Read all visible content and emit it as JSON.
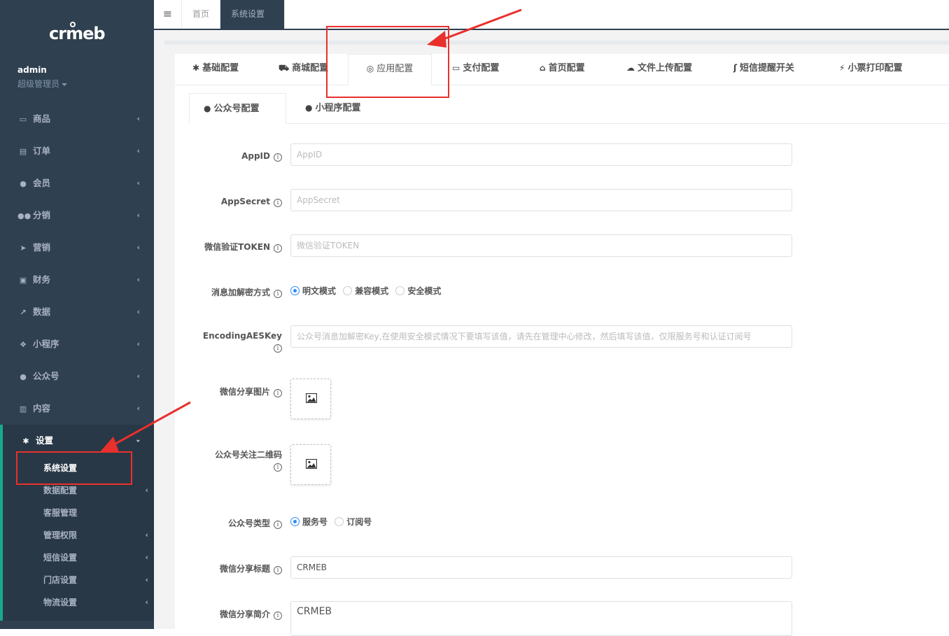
{
  "sidebar": {
    "logo": "crmeb",
    "user_name": "admin",
    "user_role": "超级管理员",
    "menu": [
      {
        "label": "商品",
        "icon": "laptop-icon"
      },
      {
        "label": "订单",
        "icon": "list-icon"
      },
      {
        "label": "会员",
        "icon": "user-icon"
      },
      {
        "label": "分销",
        "icon": "users-icon"
      },
      {
        "label": "营销",
        "icon": "paper-plane-icon"
      },
      {
        "label": "财务",
        "icon": "money-icon"
      },
      {
        "label": "数据",
        "icon": "chart-icon"
      },
      {
        "label": "小程序",
        "icon": "cubes-icon"
      },
      {
        "label": "公众号",
        "icon": "wechat-icon"
      },
      {
        "label": "内容",
        "icon": "book-icon"
      }
    ],
    "active_menu": {
      "label": "设置",
      "icon": "gear-icon"
    },
    "submenu": [
      "系统设置",
      "数据配置",
      "客服管理",
      "管理权限",
      "短信设置",
      "门店设置",
      "物流设置"
    ]
  },
  "topbar": {
    "tabs": [
      "首页",
      "系统设置"
    ]
  },
  "main_tabs": [
    "基础配置",
    "商城配置",
    "应用配置",
    "支付配置",
    "首页配置",
    "文件上传配置",
    "短信提醒开关",
    "小票打印配置"
  ],
  "sub_tabs": [
    "公众号配置",
    "小程序配置"
  ],
  "form": {
    "appid_label": "AppID",
    "appid_placeholder": "AppID",
    "appsecret_label": "AppSecret",
    "appsecret_placeholder": "AppSecret",
    "token_label": "微信验证TOKEN",
    "token_placeholder": "微信验证TOKEN",
    "encrypt_label": "消息加解密方式",
    "encrypt_options": [
      "明文模式",
      "兼容模式",
      "安全模式"
    ],
    "aeskey_label": "EncodingAESKey",
    "aeskey_placeholder": "公众号消息加解密Key,在使用安全模式情况下要填写该值，请先在管理中心修改，然后填写该值，仅限服务号和认证订阅号",
    "share_img_label": "微信分享图片",
    "qrcode_label": "公众号关注二维码",
    "type_label": "公众号类型",
    "type_options": [
      "服务号",
      "订阅号"
    ],
    "share_title_label": "微信分享标题",
    "share_title_value": "CRMEB",
    "share_desc_label": "微信分享简介",
    "share_desc_value": "CRMEB"
  },
  "colors": {
    "sidebar_bg": "#2f4050",
    "annotation_red": "#e8302c",
    "radio_blue": "#2d8cf0"
  }
}
